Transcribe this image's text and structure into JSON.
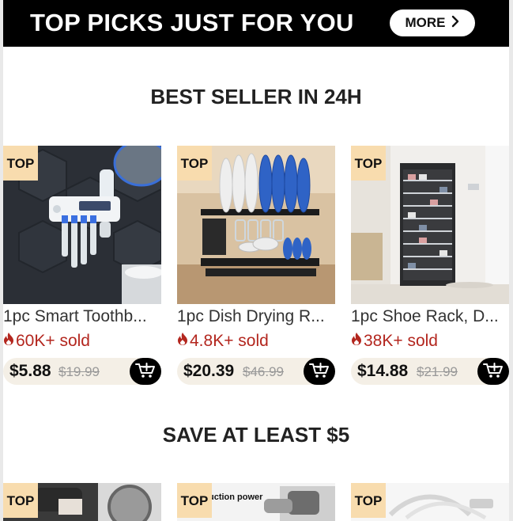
{
  "banner": {
    "title": "TOP PICKS JUST FOR YOU",
    "more_label": "MORE"
  },
  "sections": {
    "best_seller_title": "BEST SELLER IN 24H",
    "save_title": "SAVE AT LEAST $5"
  },
  "badge_label": "TOP",
  "products": [
    {
      "title": "1pc Smart Toothb...",
      "sold": "60K+ sold",
      "price": "$5.88",
      "original_price": "$19.99"
    },
    {
      "title": "1pc Dish Drying R...",
      "sold": "4.8K+ sold",
      "price": "$20.39",
      "original_price": "$46.99"
    },
    {
      "title": "1pc Shoe Rack, D...",
      "sold": "38K+ sold",
      "price": "$14.88",
      "original_price": "$21.99"
    }
  ],
  "save_products": [
    {
      "image_text": ""
    },
    {
      "image_text": "uction power"
    },
    {
      "image_text": ""
    }
  ],
  "colors": {
    "banner_bg": "#000000",
    "badge_bg": "#f8dcae",
    "sold_red": "#b3261e",
    "price_bar_bg": "#f4efe6"
  },
  "icons": {
    "more": "chevron-right-icon",
    "sold": "flame-icon",
    "cart": "add-to-cart-icon"
  }
}
